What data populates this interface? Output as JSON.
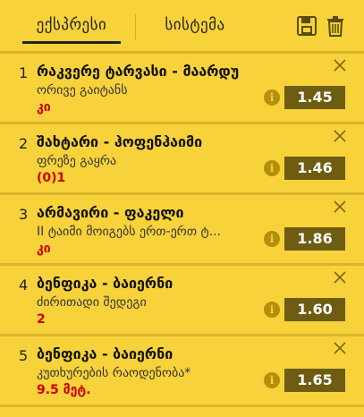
{
  "tabs": {
    "express": "ექსპრესი",
    "system": "სისტემა"
  },
  "toolbar": {
    "save_icon": "save-icon",
    "delete_icon": "trash-icon"
  },
  "bets": [
    {
      "num": "1",
      "title": "რაკვერე ტარვასი - მაარდუ",
      "market": "ორივე გაიტანს",
      "pick": "კი",
      "odds": "1.45"
    },
    {
      "num": "2",
      "title": "შახტარი - ჰოფენჰაიმი",
      "market": "ფრეზე გაყრა",
      "pick": "(0)1",
      "odds": "1.46"
    },
    {
      "num": "3",
      "title": "არმავირი - ფაკელი",
      "market": "II ტაიმი მოიგებს ერთ-ერთ ტ...",
      "pick": "კი",
      "odds": "1.86"
    },
    {
      "num": "4",
      "title": "ბენფიკა - ბაიერნი",
      "market": "ძირითადი შედეგი",
      "pick": "2",
      "odds": "1.60"
    },
    {
      "num": "5",
      "title": "ბენფიკა - ბაიერნი",
      "market": "კუთხურების რაოდენობა*",
      "pick": "9.5 მეტ.",
      "odds": "1.65"
    }
  ],
  "colors": {
    "background": "#f7d23a",
    "odds_bg": "#6e5c12",
    "pick": "#cc0000"
  }
}
